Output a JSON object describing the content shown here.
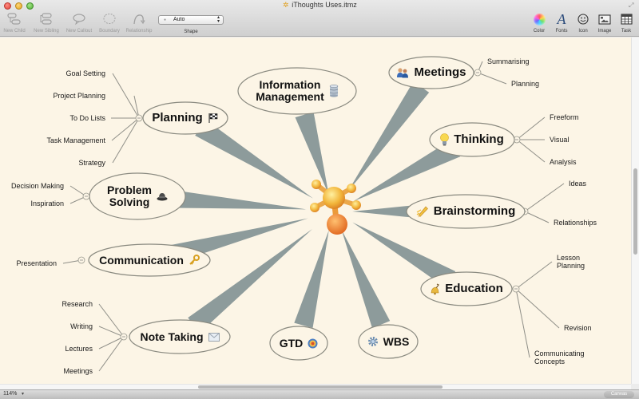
{
  "window": {
    "title": "iThoughts Uses.itmz",
    "title_icon": "ithoughts-doc-icon"
  },
  "toolbar": {
    "left_tools": [
      {
        "label": "New Child",
        "icon": "new-child-icon",
        "enabled": false
      },
      {
        "label": "New Sibling",
        "icon": "new-sibling-icon",
        "enabled": false
      },
      {
        "label": "New Callout",
        "icon": "new-callout-icon",
        "enabled": false
      },
      {
        "label": "Boundary",
        "icon": "boundary-icon",
        "enabled": false
      },
      {
        "label": "Relationship",
        "icon": "relationship-icon",
        "enabled": false
      }
    ],
    "shape": {
      "label": "Shape",
      "value": "Auto"
    },
    "right_tools": [
      {
        "label": "Color",
        "icon": "color-wheel-icon"
      },
      {
        "label": "Fonts",
        "icon": "fonts-icon"
      },
      {
        "label": "Icon",
        "icon": "smiley-icon"
      },
      {
        "label": "Image",
        "icon": "image-icon"
      },
      {
        "label": "Task",
        "icon": "task-grid-icon"
      }
    ]
  },
  "mindmap": {
    "central_icon": "ithoughts-logo-icon",
    "colors": {
      "background": "#fcf5e6",
      "branch": "#8d9b9b",
      "node_fill": "#fcf5e6",
      "node_stroke": "#8a8a80",
      "leaf_line": "#8f8f88"
    },
    "branches": [
      {
        "id": "planning",
        "label": "Planning",
        "icon": "checkered-flag-icon",
        "children": [
          "Goal Setting",
          "Project Planning",
          "To Do Lists",
          "Task Management",
          "Strategy"
        ]
      },
      {
        "id": "problem-solving",
        "label": "Problem\nSolving",
        "icon": "hat-icon",
        "children": [
          "Decision Making",
          "Inspiration"
        ]
      },
      {
        "id": "communication",
        "label": "Communication",
        "icon": "key-icon",
        "children": [
          "Presentation"
        ]
      },
      {
        "id": "note-taking",
        "label": "Note Taking",
        "icon": "envelope-icon",
        "children": [
          "Research",
          "Writing",
          "Lectures",
          "Meetings"
        ]
      },
      {
        "id": "gtd",
        "label": "GTD",
        "icon": "target-icon",
        "children": []
      },
      {
        "id": "wbs",
        "label": "WBS",
        "icon": "gear-icon",
        "children": []
      },
      {
        "id": "information-management",
        "label": "Information\nManagement",
        "icon": "database-icon",
        "children": []
      },
      {
        "id": "meetings",
        "label": "Meetings",
        "icon": "people-icon",
        "children": [
          "Summarising",
          "Planning"
        ]
      },
      {
        "id": "thinking",
        "label": "Thinking",
        "icon": "lightbulb-icon",
        "children": [
          "Freeform",
          "Visual",
          "Analysis"
        ]
      },
      {
        "id": "brainstorming",
        "label": "Brainstorming",
        "icon": "pencil-icon",
        "children": [
          "Ideas",
          "Relationships"
        ]
      },
      {
        "id": "education",
        "label": "Education",
        "icon": "bell-icon",
        "children": [
          "Lesson\nPlanning",
          "Revision",
          "Communicating\nConcepts"
        ]
      }
    ]
  },
  "statusbar": {
    "zoom": "114%",
    "canvas_button": "Canvas"
  }
}
